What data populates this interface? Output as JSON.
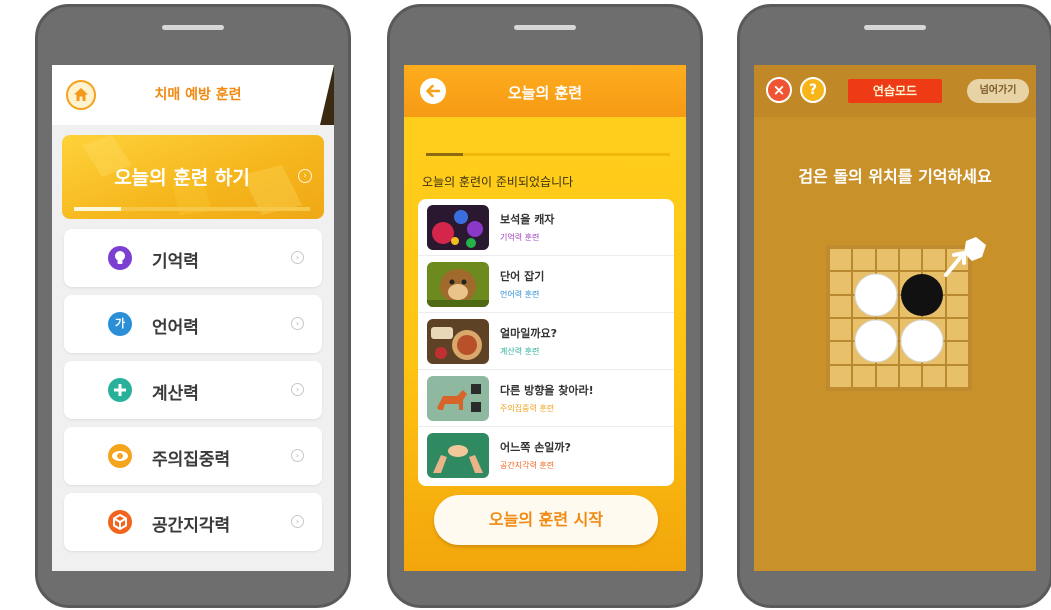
{
  "phone1": {
    "header_title": "치매 예방 훈련",
    "today_label": "오늘의 훈련 하기",
    "today_progress": 0.2,
    "categories": [
      {
        "name": "기억력",
        "icon": "lightbulb-icon",
        "color": "#7b3fd1"
      },
      {
        "name": "언어력",
        "icon_text": "가",
        "icon": "language-icon",
        "color": "#2a8fd6"
      },
      {
        "name": "계산력",
        "icon": "plus-icon",
        "color": "#28b09a"
      },
      {
        "name": "주의집중력",
        "icon": "eye-icon",
        "color": "#f5a51c"
      },
      {
        "name": "공간지각력",
        "icon": "cube-icon",
        "color": "#f0641e"
      }
    ],
    "accent": "#f08a12"
  },
  "phone2": {
    "header_title": "오늘의 훈련",
    "progress": 0.15,
    "message": "오늘의 훈련이 준비되었습니다",
    "games": [
      {
        "name": "보석을 캐자",
        "category": "기억력 훈련",
        "cat_color": "#a040c0"
      },
      {
        "name": "단어 잡기",
        "category": "언어력 훈련",
        "cat_color": "#2a8fd6"
      },
      {
        "name": "얼마일까요?",
        "category": "계산력 훈련",
        "cat_color": "#28b09a"
      },
      {
        "name": "다른 방향을 찾아라!",
        "category": "주의집중력 훈련",
        "cat_color": "#f0a21a"
      },
      {
        "name": "어느쪽 손일까?",
        "category": "공간지각력 훈련",
        "cat_color": "#f0641e"
      }
    ],
    "start_label": "오늘의 훈련 시작"
  },
  "phone3": {
    "close_label": "×",
    "help_label": "?",
    "mode_label": "연습모드",
    "skip_label": "넘어가기",
    "question": "검은 돌의 위치를 기억하세요"
  }
}
